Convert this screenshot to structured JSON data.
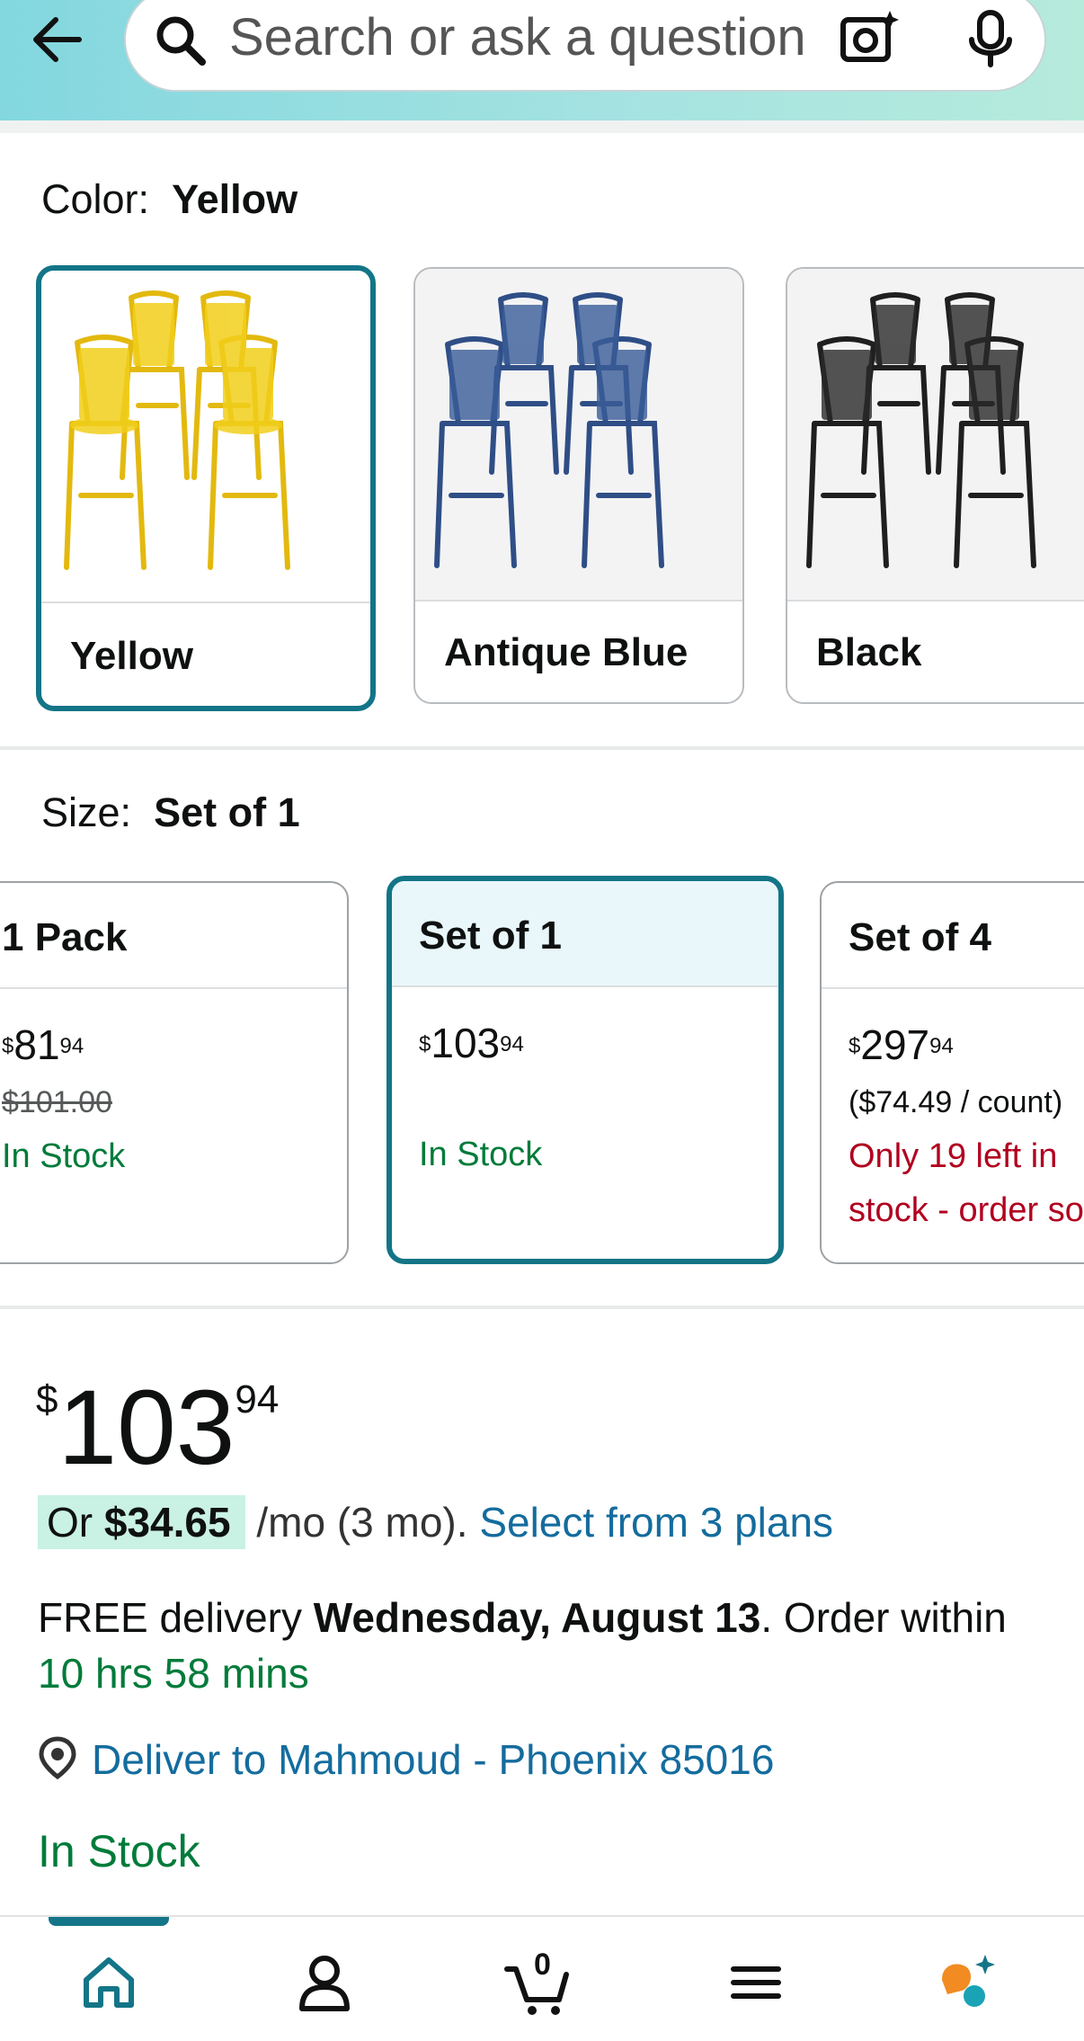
{
  "search": {
    "placeholder": "Search or ask a question"
  },
  "color": {
    "label": "Color:",
    "selected": "Yellow",
    "options": [
      {
        "name": "Yellow",
        "swatch": "#f2cf1b"
      },
      {
        "name": "Antique Blue",
        "swatch": "#2f4e86"
      },
      {
        "name": "Black",
        "swatch": "#1f1f1f"
      }
    ]
  },
  "size": {
    "label": "Size:",
    "selected": "Set of 1",
    "options": [
      {
        "name": "1 Pack",
        "price_whole": "81",
        "price_cents": "94",
        "list_price": "$101.00",
        "stock": "In Stock"
      },
      {
        "name": "Set of 1",
        "price_whole": "103",
        "price_cents": "94",
        "stock": "In Stock"
      },
      {
        "name": "Set of 4",
        "price_whole": "297",
        "price_cents": "94",
        "per_count": "($74.49 / count)",
        "stock_line1": "Only 19 left in",
        "stock_line2": "stock - order soon."
      }
    ]
  },
  "price": {
    "currency": "$",
    "whole": "103",
    "cents": "94"
  },
  "monthly": {
    "prefix": "Or",
    "amount": "$34.65",
    "suffix": "/mo (3 mo).",
    "link": "Select from 3 plans"
  },
  "delivery": {
    "free": "FREE delivery",
    "date": "Wednesday, August 13",
    "order_within": ". Order within",
    "countdown": "10 hrs 58 mins"
  },
  "deliver_to": "Deliver to Mahmoud - Phoenix 85016",
  "stock_status": "In Stock",
  "nav": {
    "cart_count": "0",
    "items": [
      "home-icon",
      "user-icon",
      "cart-icon",
      "menu-icon",
      "rufus-icon"
    ]
  },
  "colors": {
    "accent": "#137587",
    "link": "#146c9e",
    "green": "#007b3a",
    "red": "#b1001f"
  }
}
